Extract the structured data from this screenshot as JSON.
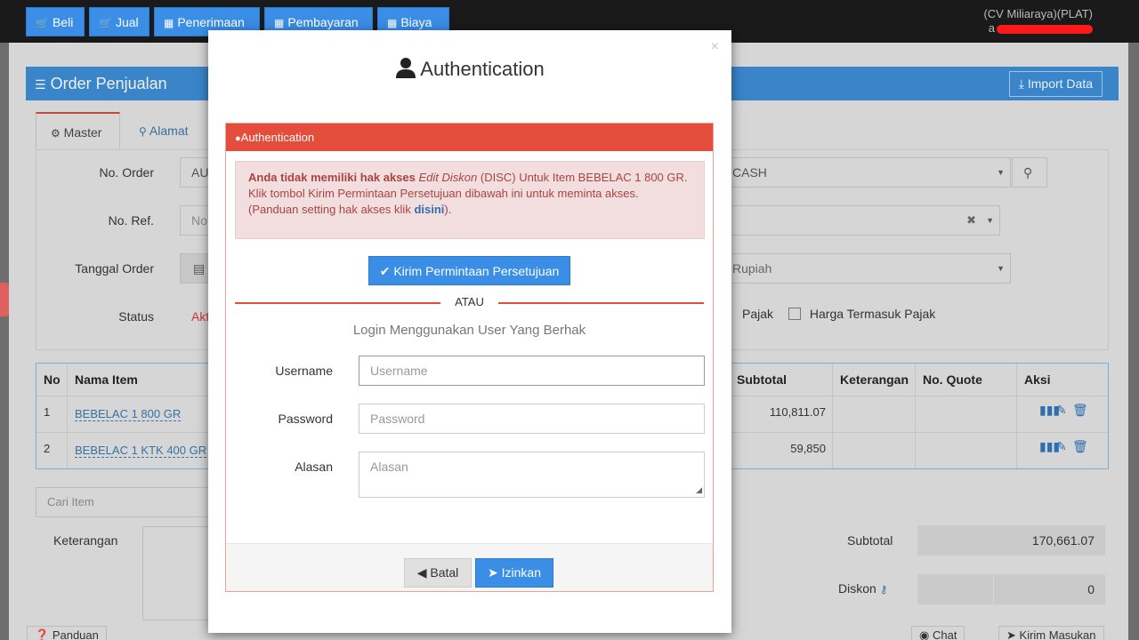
{
  "navbar": {
    "buttons": [
      {
        "label": "Beli",
        "icon": "cart-icon"
      },
      {
        "label": "Jual",
        "icon": "cart-icon"
      },
      {
        "label": "Penerimaan",
        "icon": "money-icon"
      },
      {
        "label": "Pembayaran",
        "icon": "money-icon"
      },
      {
        "label": "Biaya",
        "icon": "money-icon"
      }
    ],
    "company": "(CV Miliaraya)(PLAT)",
    "user_initial": "a"
  },
  "panel": {
    "title": "Order Penjualan",
    "import_label": "Import Data"
  },
  "tabs": [
    {
      "label": "Master",
      "active": true
    },
    {
      "label": "Alamat",
      "active": false
    }
  ],
  "form": {
    "no_order_label": "No. Order",
    "no_order_value": "AU",
    "no_ref_label": "No. Ref.",
    "no_ref_placeholder": "No",
    "tanggal_label": "Tanggal Order",
    "status_label": "Status",
    "status_value": "Akt",
    "payment_value": "CASH",
    "currency_value": "Rupiah",
    "pajak_label": "Pajak",
    "harga_pajak_label": "Harga Termasuk Pajak"
  },
  "table": {
    "headers": [
      "No",
      "Nama Item",
      "Subtotal",
      "Keterangan",
      "No. Quote",
      "Aksi"
    ],
    "rows": [
      {
        "no": "1",
        "item": "BEBELAC 1 800 GR",
        "subtotal": "110,811.07"
      },
      {
        "no": "2",
        "item": "BEBELAC 1 KTK 400 GR",
        "subtotal": "59,850"
      }
    ]
  },
  "cari_placeholder": "Cari Item",
  "keterangan_label": "Keterangan",
  "summary": {
    "subtotal_label": "Subtotal",
    "subtotal_value": "170,661.07",
    "diskon_label": "Diskon",
    "diskon_value": "0"
  },
  "bottom": {
    "panduan": "Panduan",
    "chat": "Chat",
    "kirim_masukan": "Kirim Masukan"
  },
  "modal": {
    "close": "×",
    "title": "Authentication",
    "panel_title": "Authentication",
    "alert_bold": "Anda tidak memiliki hak akses",
    "alert_italic": "Edit Diskon",
    "alert_rest": " (DISC) Untuk Item BEBELAC 1 800 GR. Klik tombol Kirim Permintaan Persetujuan dibawah ini untuk meminta akses. (Panduan setting hak akses klik ",
    "alert_link": "disini",
    "alert_end": ").",
    "kirim_label": "Kirim Permintaan Persetujuan",
    "or_text": "ATAU",
    "login_text": "Login Menggunakan User Yang Berhak",
    "username_label": "Username",
    "username_placeholder": "Username",
    "password_label": "Password",
    "password_placeholder": "Password",
    "alasan_label": "Alasan",
    "alasan_placeholder": "Alasan",
    "batal_label": "Batal",
    "izinkan_label": "Izinkan"
  },
  "colors": {
    "primary": "#3a8ee6",
    "danger": "#e44c3c",
    "alert_bg": "#f2dede",
    "alert_text": "#a94442"
  }
}
